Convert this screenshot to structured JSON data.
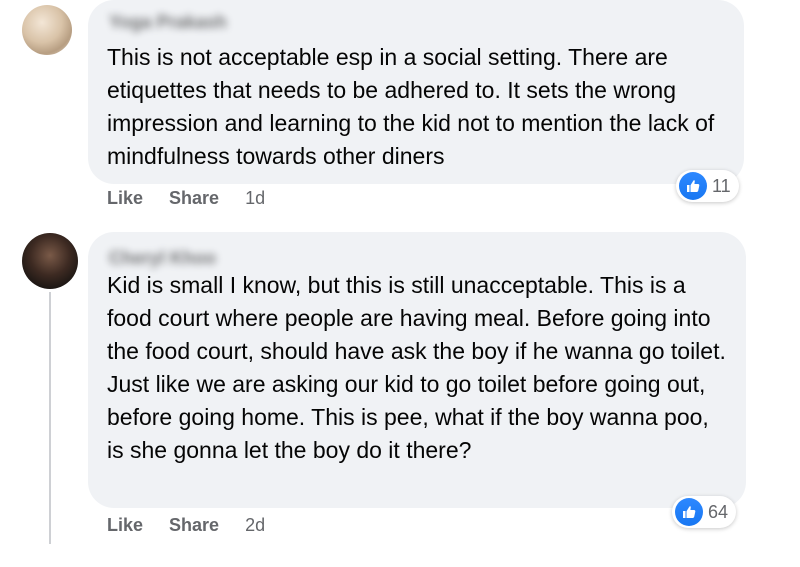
{
  "comments": [
    {
      "author": "Yoga Prakash",
      "text": "This is not acceptable esp in a social setting. There are etiquettes that needs to be adhered to. It sets the wrong impression and learning to the kid not to mention the lack of mindfulness towards other diners",
      "reaction_count": "11",
      "like_label": "Like",
      "share_label": "Share",
      "time": "1d"
    },
    {
      "author": "Cheryl Khoo",
      "text": "Kid is small I know, but this is still unacceptable. This is a food court where people are having meal. Before going into the food court, should have ask the boy if he wanna go toilet. Just like we are asking our kid to go toilet before going out, before going home. This is pee, what if the boy wanna poo, is she gonna let the boy do it there?",
      "reaction_count": "64",
      "like_label": "Like",
      "share_label": "Share",
      "time": "2d"
    }
  ],
  "colors": {
    "bubble_bg": "#f0f2f5",
    "like_blue": "#1877f2",
    "secondary_text": "#65676b"
  },
  "icons": {
    "reaction": "thumbs-up-icon"
  }
}
